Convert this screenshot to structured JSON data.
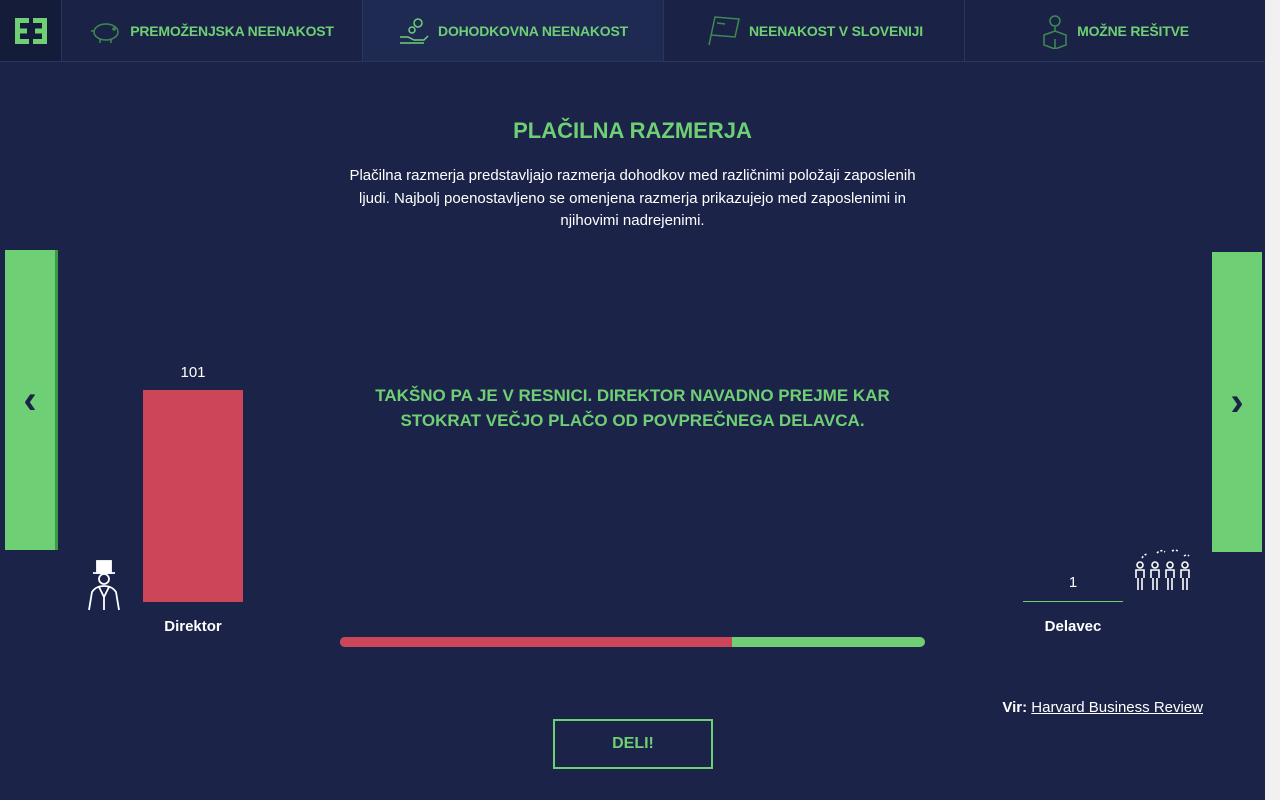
{
  "nav": {
    "logo_text": "EE",
    "tabs": [
      {
        "label": "Premoženjska neenakost",
        "icon": "piggy-bank-icon"
      },
      {
        "label": "Dohodkovna neenakost",
        "icon": "hand-coins-icon"
      },
      {
        "label": "Neenakost v Sloveniji",
        "icon": "flag-icon"
      },
      {
        "label": "Možne rešitve",
        "icon": "lightbulb-box-icon"
      }
    ],
    "active_tab": 1
  },
  "page": {
    "title": "PLAČILNA RAZMERJA",
    "intro": "Plačilna razmerja predstavljajo razmerja dohodkov med različnimi položaji zaposlenih ljudi. Najbolj poenostavljeno se omenjena razmerja prikazujejo med zaposlenimi in njihovimi nadrejenimi.",
    "statement": "TAKŠNO PA JE V RESNICI. DIREKTOR NAVADNO PREJME KAR STOKRAT VEČJO PLAČO OD POVPREČNEGA DELAVCA.",
    "prev_arrow": "‹",
    "next_arrow": "›"
  },
  "chart_data": {
    "type": "bar",
    "categories": [
      "Direktor",
      "Delavec"
    ],
    "values": [
      101,
      1
    ],
    "colors": [
      "#cc4558",
      "#6fcf75"
    ],
    "max": 101
  },
  "progress": {
    "fraction": 0.67,
    "filled_color": "#cc4558",
    "rest_color": "#6fcf75"
  },
  "source": {
    "prefix": "Vir:",
    "link_text": "Harvard Business Review"
  },
  "share": {
    "label": "DELI!"
  },
  "icons": {
    "left": "director-top-hat-icon",
    "right": "workers-group-icon"
  },
  "colors": {
    "background": "#1b2448",
    "accent": "#6fcf75",
    "bar": "#cc4558"
  }
}
